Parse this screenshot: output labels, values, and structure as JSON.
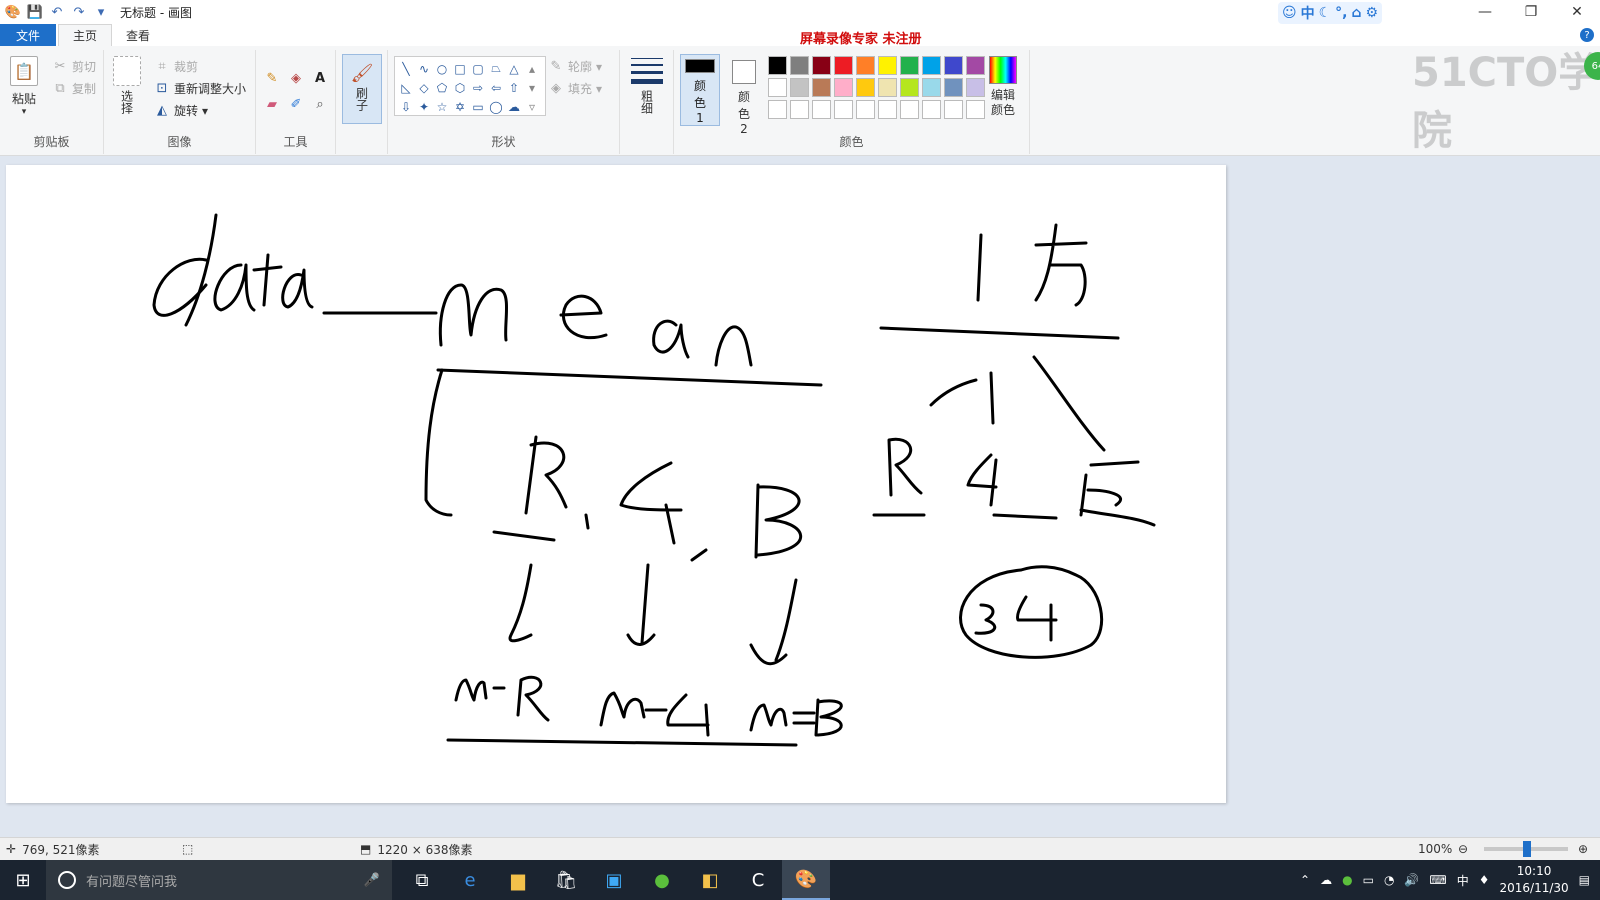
{
  "window": {
    "title": "无标题 - 画图",
    "min": "—",
    "restore": "❐",
    "close": "✕"
  },
  "ime": {
    "items": [
      "中",
      "☾",
      "°,",
      "⌂",
      "⚙"
    ]
  },
  "recorder_banner": "屏幕录像专家  未注册",
  "tabs": {
    "file": "文件",
    "home": "主页",
    "view": "查看"
  },
  "ribbon": {
    "clipboard": {
      "label": "剪贴板",
      "paste": "粘贴",
      "cut": "剪切",
      "copy": "复制"
    },
    "image": {
      "label": "图像",
      "select": "选择",
      "crop": "裁剪",
      "resize": "重新调整大小",
      "rotate": "旋转"
    },
    "tools": {
      "label": "工具"
    },
    "brushes": {
      "label": "刷子"
    },
    "shapes": {
      "label": "形状",
      "outline": "轮廓",
      "fill": "填充"
    },
    "size": {
      "label": "粗细"
    },
    "color1": {
      "label": "颜色 1"
    },
    "color2": {
      "label": "颜色 2"
    },
    "colors": {
      "label": "颜色",
      "edit": "编辑颜色"
    }
  },
  "palette_row1": [
    "#000000",
    "#7f7f7f",
    "#880015",
    "#ed1c24",
    "#ff7f27",
    "#fff200",
    "#22b14c",
    "#00a2e8",
    "#3f48cc",
    "#a349a4"
  ],
  "palette_row2": [
    "#ffffff",
    "#c3c3c3",
    "#b97a57",
    "#ffaec9",
    "#ffc90e",
    "#efe4b0",
    "#b5e61d",
    "#99d9ea",
    "#7092be",
    "#c8bfe7"
  ],
  "watermark": "51CTO学院",
  "status": {
    "cursor": "769, 521像素",
    "size": "1220 × 638像素",
    "zoom": "100%"
  },
  "taskbar": {
    "search_placeholder": "有问题尽管问我",
    "time": "10:10",
    "date": "2016/11/30",
    "ime": "中"
  },
  "drawing": {
    "words": [
      "data",
      "mean",
      "1万",
      "R",
      "G",
      "B",
      "m-R",
      "m-G",
      "m=B",
      "34"
    ]
  }
}
